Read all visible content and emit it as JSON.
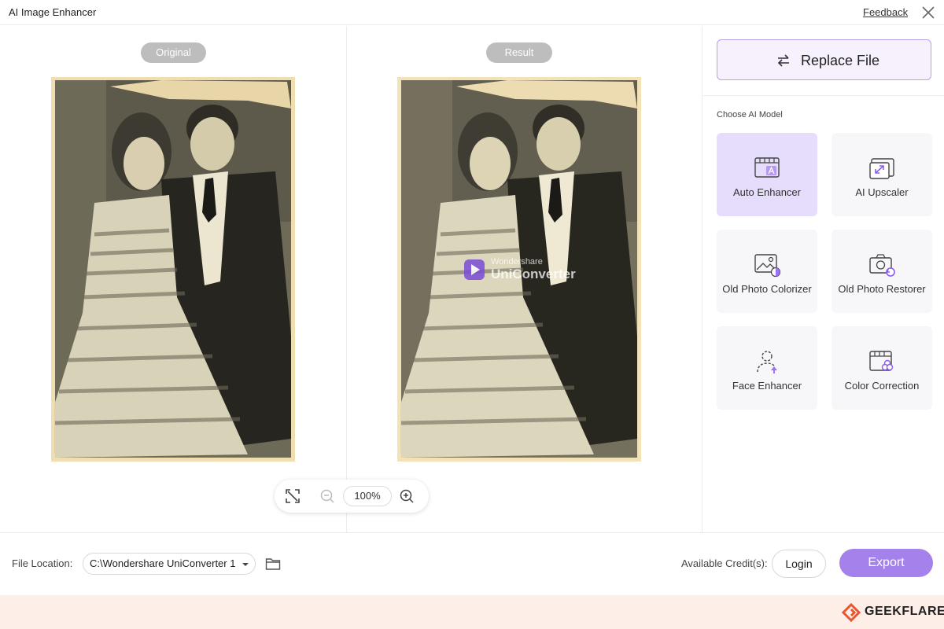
{
  "window": {
    "title": "AI Image Enhancer",
    "feedback_label": "Feedback",
    "close_icon": "close-icon"
  },
  "preview": {
    "original_label": "Original",
    "result_label": "Result",
    "watermark_line1": "Wondershare",
    "watermark_line2": "UniConverter",
    "zoom_value": "100%"
  },
  "panel": {
    "replace_label": "Replace File",
    "section_label": "Choose AI Model",
    "accent_color": "#a582eb",
    "models": [
      {
        "label": "Auto Enhancer",
        "icon": "auto-enhancer-icon",
        "active": true
      },
      {
        "label": "AI Upscaler",
        "icon": "upscaler-icon",
        "active": false
      },
      {
        "label": "Old Photo Colorizer",
        "icon": "colorizer-icon",
        "active": false
      },
      {
        "label": "Old Photo Restorer",
        "icon": "restorer-icon",
        "active": false
      },
      {
        "label": "Face Enhancer",
        "icon": "face-enhancer-icon",
        "active": false
      },
      {
        "label": "Color Correction",
        "icon": "color-correction-icon",
        "active": false
      }
    ]
  },
  "footer": {
    "file_location_label": "File Location:",
    "file_location_value": "C:\\Wondershare UniConverter 1",
    "credits_label": "Available Credit(s):",
    "login_label": "Login",
    "export_label": "Export"
  },
  "brand": {
    "name": "GEEKFLARE",
    "color": "#e8552e"
  }
}
